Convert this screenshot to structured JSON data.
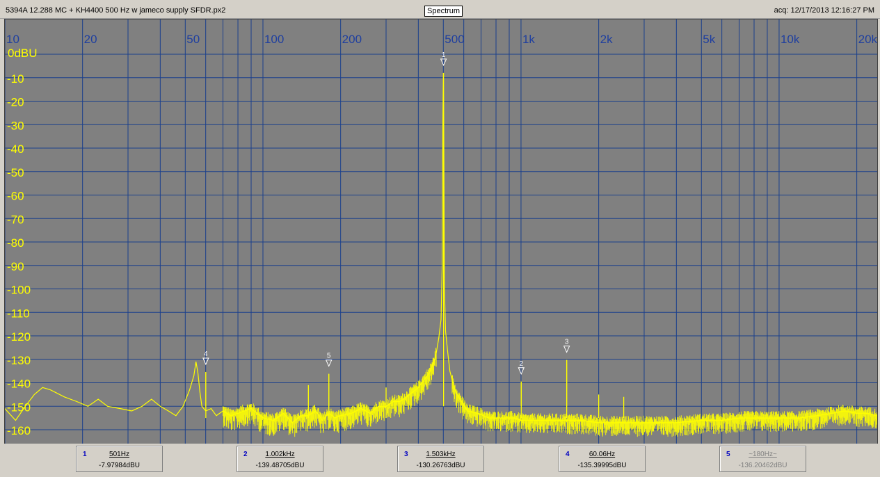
{
  "window": {
    "file_title": "5394A 12.288 MC + KH4400 500 Hz w jameco supply SFDR.px2",
    "mode": "Spectrum",
    "acq": "acq: 12/17/2013 12:16:27 PM"
  },
  "colors": {
    "plot_background": "#808080",
    "grid": "#1a3f8c",
    "x_tick_label": "#1f3f9f",
    "trace": "#ffff00",
    "y_tick_label": "#ffff00"
  },
  "chart_data": {
    "type": "line",
    "x_scale": "log",
    "xlim": [
      10,
      24000
    ],
    "ylim": [
      -165,
      0
    ],
    "ylabel": "0dBU",
    "x_ticks": [
      {
        "value": 10,
        "label": "10"
      },
      {
        "value": 20,
        "label": "20"
      },
      {
        "value": 50,
        "label": "50"
      },
      {
        "value": 100,
        "label": "100"
      },
      {
        "value": 200,
        "label": "200"
      },
      {
        "value": 500,
        "label": "500"
      },
      {
        "value": 1000,
        "label": "1k"
      },
      {
        "value": 2000,
        "label": "2k"
      },
      {
        "value": 5000,
        "label": "5k"
      },
      {
        "value": 10000,
        "label": "10k"
      },
      {
        "value": 20000,
        "label": "20k"
      }
    ],
    "y_ticks": [
      {
        "value": -10,
        "label": "-10"
      },
      {
        "value": -20,
        "label": "-20"
      },
      {
        "value": -30,
        "label": "-30"
      },
      {
        "value": -40,
        "label": "-40"
      },
      {
        "value": -50,
        "label": "-50"
      },
      {
        "value": -60,
        "label": "-60"
      },
      {
        "value": -70,
        "label": "-70"
      },
      {
        "value": -80,
        "label": "-80"
      },
      {
        "value": -90,
        "label": "-90"
      },
      {
        "value": -100,
        "label": "-100"
      },
      {
        "value": -110,
        "label": "-110"
      },
      {
        "value": -120,
        "label": "-120"
      },
      {
        "value": -130,
        "label": "-130"
      },
      {
        "value": -140,
        "label": "-140"
      },
      {
        "value": -150,
        "label": "-150"
      },
      {
        "value": -160,
        "label": "-160"
      }
    ],
    "grid": true,
    "series": [
      {
        "x": [
          10,
          11,
          12,
          13,
          14,
          15,
          17,
          19,
          21,
          23,
          25,
          28,
          31,
          34,
          37,
          40,
          43,
          46,
          49,
          52,
          54,
          55,
          56,
          57,
          58,
          60,
          63,
          66,
          70,
          75,
          80,
          90,
          100,
          110,
          120,
          130,
          140,
          150,
          160,
          170,
          180,
          190,
          200,
          220,
          240,
          260,
          280,
          300,
          320,
          340,
          360,
          380,
          400,
          420,
          440,
          460,
          470,
          480,
          490,
          495,
          498,
          500,
          502,
          505,
          510,
          520,
          530,
          550,
          580,
          620,
          680,
          750,
          850,
          950,
          1000,
          1100,
          1300,
          1500,
          1700,
          2000,
          2500,
          3000,
          4000,
          5000,
          6000,
          7000,
          8000,
          10000,
          12000,
          14000,
          16000,
          18000,
          20000,
          22000,
          24000
        ],
        "y": [
          -151,
          -156,
          -150,
          -145,
          -142,
          -143,
          -146,
          -148,
          -150,
          -147,
          -150,
          -151,
          -152,
          -150,
          -147,
          -150,
          -152,
          -154,
          -150,
          -143,
          -137,
          -131,
          -136,
          -144,
          -150,
          -152,
          -151,
          -154,
          -152,
          -154,
          -153,
          -151,
          -155,
          -156,
          -153,
          -157,
          -154,
          -154,
          -152,
          -156,
          -153,
          -155,
          -154,
          -153,
          -151,
          -153,
          -150,
          -150,
          -148,
          -148,
          -146,
          -144,
          -142,
          -139,
          -136,
          -131,
          -127,
          -121,
          -113,
          -90,
          -30,
          -8,
          -30,
          -100,
          -118,
          -127,
          -135,
          -142,
          -147,
          -152,
          -153,
          -155,
          -155,
          -155,
          -156,
          -156,
          -156,
          -156,
          -156,
          -157,
          -157,
          -157,
          -157,
          -156,
          -156,
          -155,
          -155,
          -155,
          -155,
          -154,
          -153,
          -152,
          -153,
          -153,
          -154
        ]
      }
    ],
    "spurs": [
      {
        "x": 60.06,
        "y": -135.4
      },
      {
        "x": 180,
        "y": -136.2
      },
      {
        "x": 150,
        "y": -141
      },
      {
        "x": 1002,
        "y": -139.5
      },
      {
        "x": 1503,
        "y": -130.3
      },
      {
        "x": 2000,
        "y": -145
      },
      {
        "x": 2500,
        "y": -146
      },
      {
        "x": 300,
        "y": -142
      }
    ],
    "markers": [
      {
        "id": "1",
        "freq": "501Hz",
        "x": 501,
        "y": -7.97984,
        "level": "-7.97984dBU",
        "active": true
      },
      {
        "id": "2",
        "freq": "1.002kHz",
        "x": 1002,
        "y": -139.48705,
        "level": "-139.48705dBU",
        "active": true
      },
      {
        "id": "3",
        "freq": "1.503kHz",
        "x": 1503,
        "y": -130.26763,
        "level": "-130.26763dBU",
        "active": true
      },
      {
        "id": "4",
        "freq": "60.06Hz",
        "x": 60.06,
        "y": -135.39995,
        "level": "-135.39995dBU",
        "active": true
      },
      {
        "id": "5",
        "freq": "~180Hz~",
        "x": 180,
        "y": -136.20462,
        "level": "-136.20462dBU",
        "active": false
      }
    ]
  }
}
